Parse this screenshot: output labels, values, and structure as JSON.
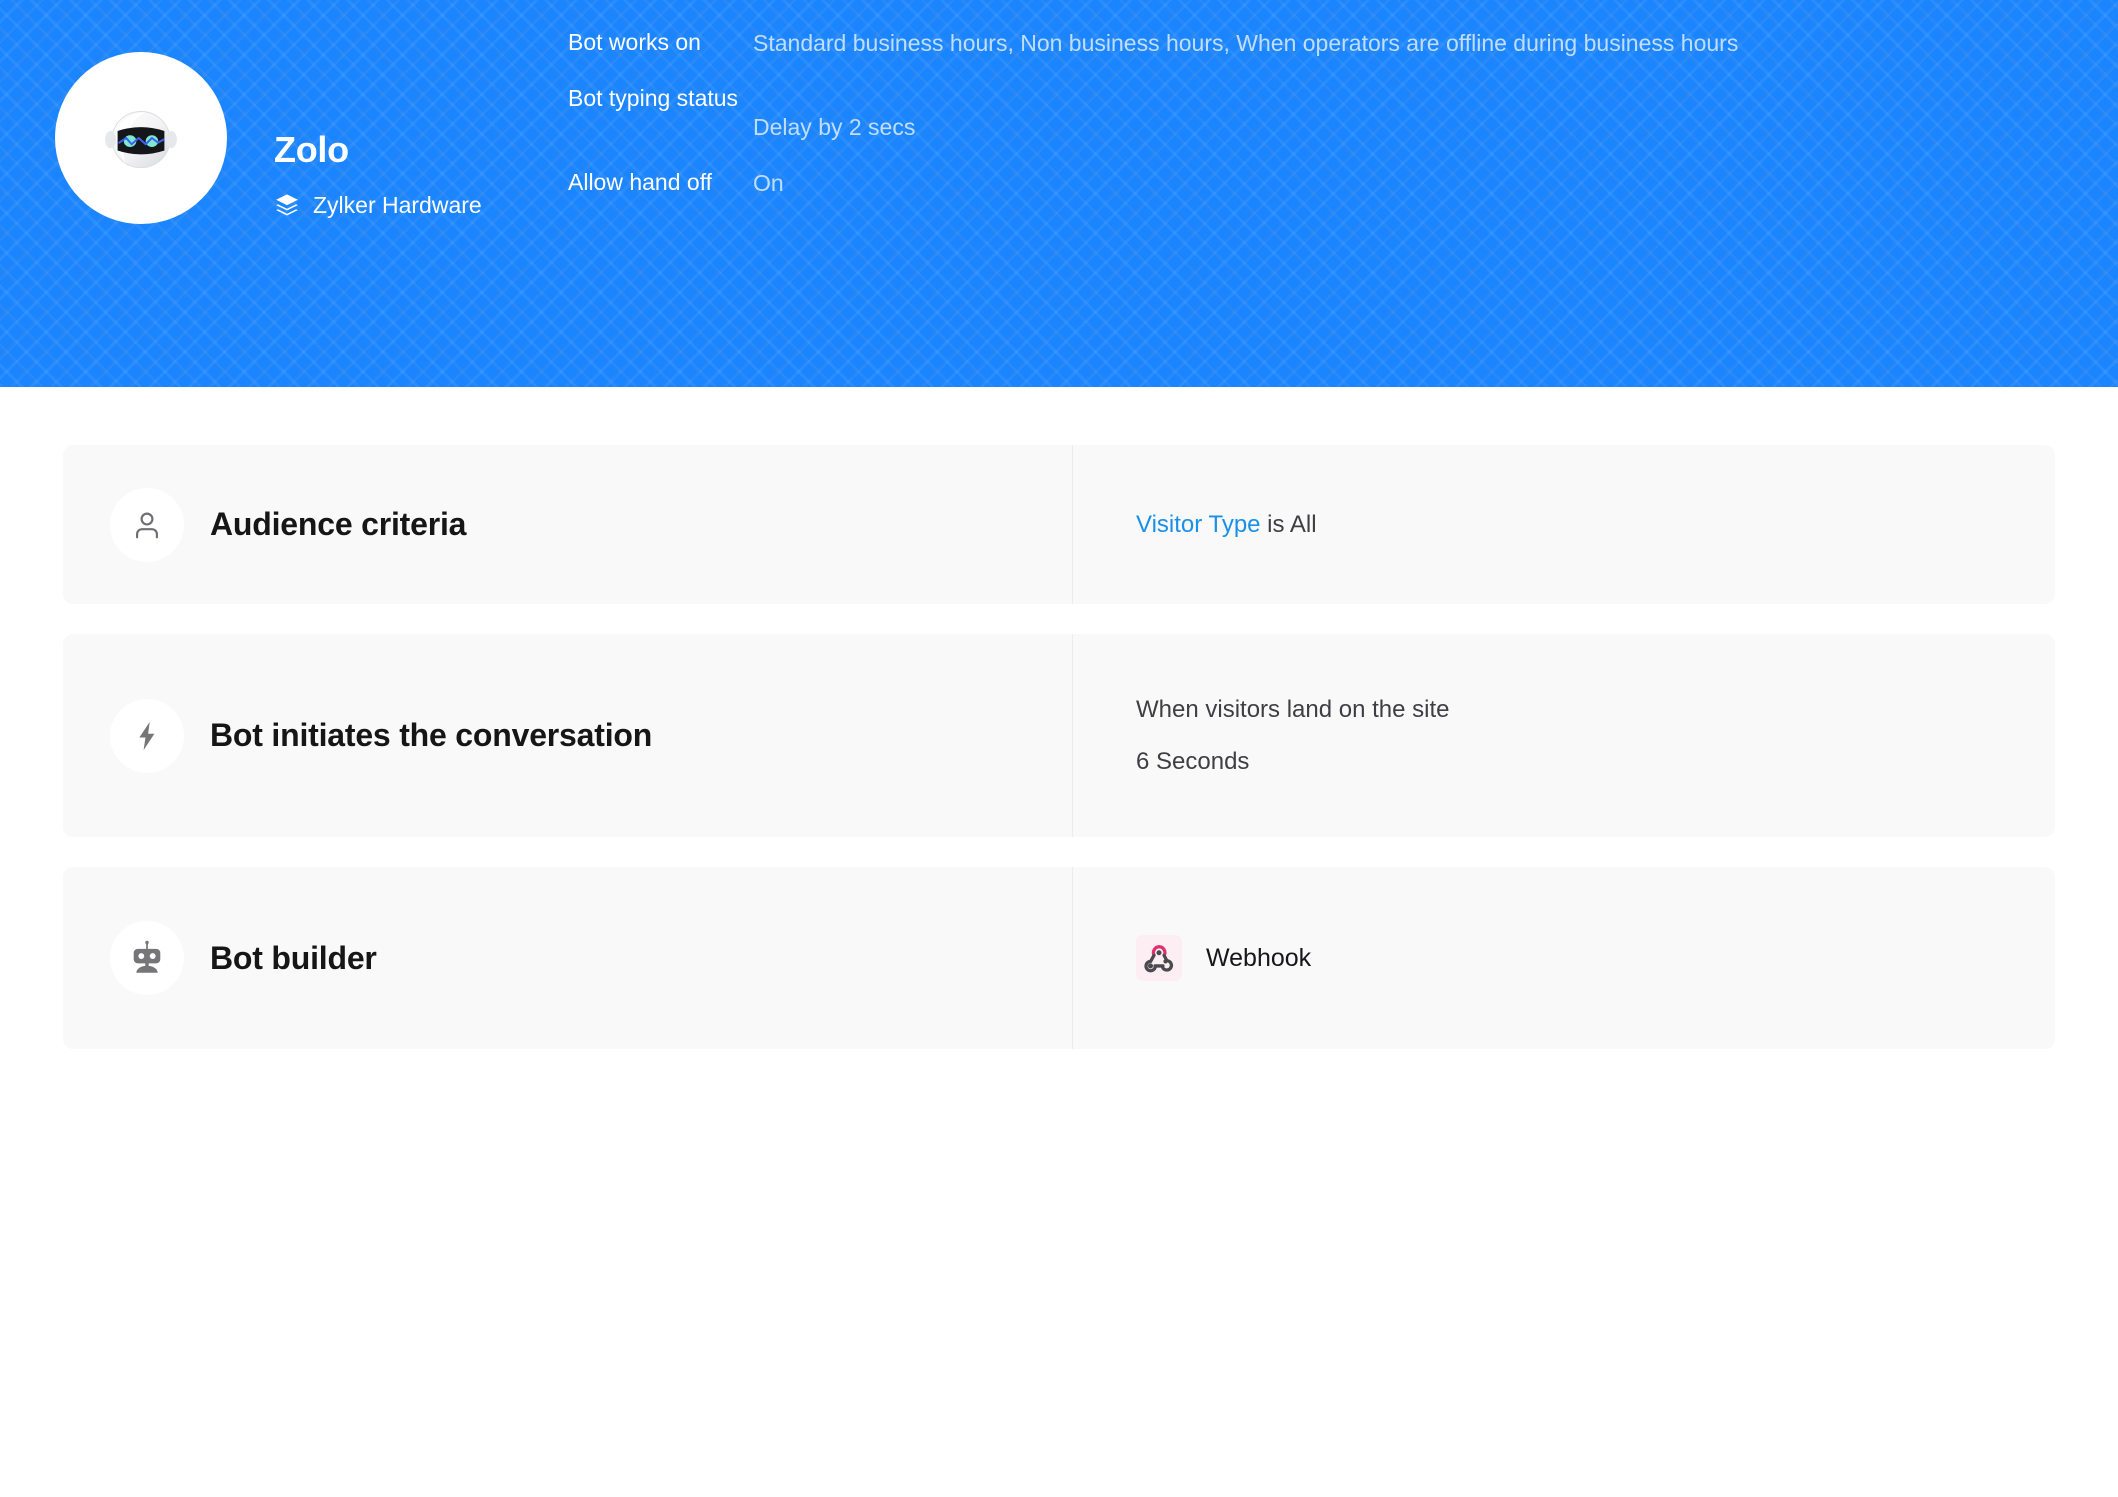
{
  "theme": {
    "header_blue": "#1a85ff",
    "card_bg": "#f9f9fa",
    "link_blue": "#1a90e8",
    "webhook_pink": "#e0316b",
    "icon_gray": "#767679"
  },
  "header": {
    "avatar_icon": "bot-avatar-icon",
    "bot_name": "Zolo",
    "brand_icon": "layers-icon",
    "brand_name": "Zylker Hardware",
    "meta": [
      {
        "key": "Bot works on",
        "value": "Standard business hours, Non business hours, When operators are offline during business hours"
      },
      {
        "key": "Bot typing status",
        "value": "Delay by 2 secs"
      },
      {
        "key": "Allow hand off",
        "value": "On"
      }
    ]
  },
  "rows": {
    "audience": {
      "icon": "person-icon",
      "title": "Audience criteria",
      "link_text": "Visitor Type",
      "rest_text": " is All"
    },
    "initiates": {
      "icon": "lightning-bolt-icon",
      "title": "Bot initiates the conversation",
      "line1": "When visitors land on the site",
      "line2": "6 Seconds"
    },
    "builder": {
      "icon": "robot-icon",
      "title": "Bot builder",
      "badge_icon": "webhook-icon",
      "badge_label": "Webhook"
    }
  }
}
